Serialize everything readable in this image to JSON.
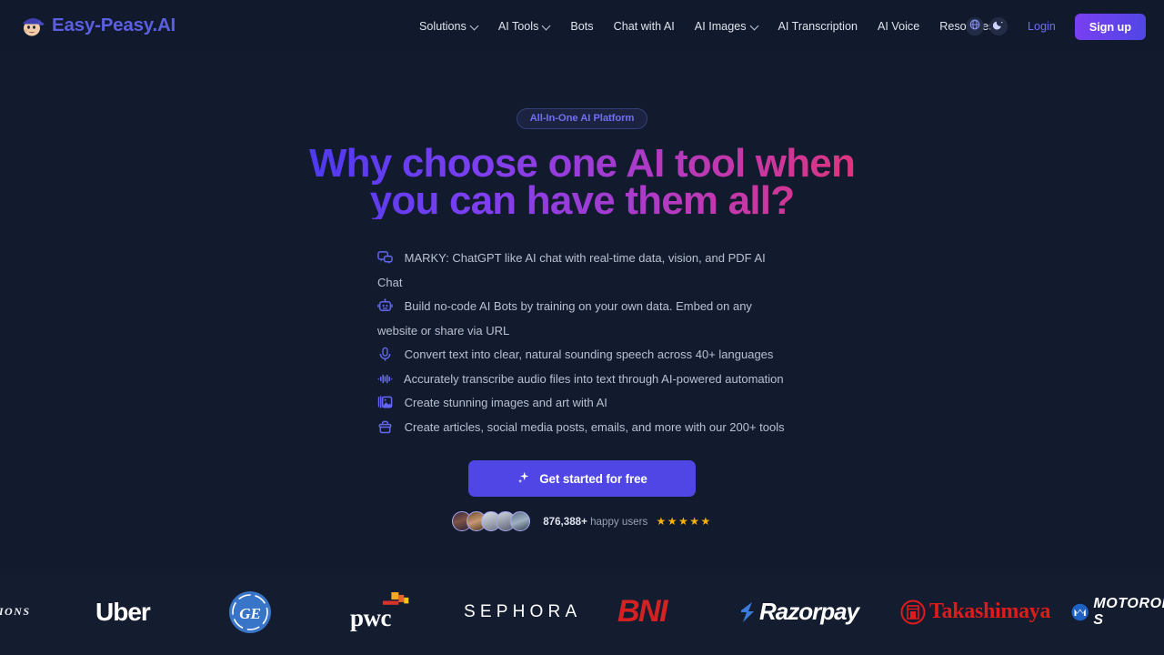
{
  "brand": {
    "name": "Easy-Peasy.AI",
    "logo_icon": "mascot-avatar-icon",
    "color": "#5b5fe0"
  },
  "nav": {
    "items": [
      {
        "label": "Solutions",
        "has_dropdown": true
      },
      {
        "label": "AI Tools",
        "has_dropdown": true
      },
      {
        "label": "Bots",
        "has_dropdown": false
      },
      {
        "label": "Chat with AI",
        "has_dropdown": false
      },
      {
        "label": "AI Images",
        "has_dropdown": true
      },
      {
        "label": "AI Transcription",
        "has_dropdown": false
      },
      {
        "label": "AI Voice",
        "has_dropdown": false
      },
      {
        "label": "Resources",
        "has_dropdown": true
      }
    ],
    "language_icon": "globe-icon",
    "theme_icon": "moon-icon",
    "login_label": "Login",
    "signup_label": "Sign up",
    "signup_color": "#5b46e8"
  },
  "hero": {
    "badge": "All-In-One AI Platform",
    "headline_line1": "Why choose one AI tool when",
    "headline_line2": "you can have them all?",
    "headline_gradient_from": "#4338f0",
    "headline_gradient_to": "#e8336f",
    "features": [
      {
        "icon": "chat-bubbles-icon",
        "text": "MARKY: ChatGPT like AI chat with real-time data, vision, and PDF AI Chat"
      },
      {
        "icon": "robot-icon",
        "text": "Build no-code AI Bots by training on your own data. Embed on any website or share via URL"
      },
      {
        "icon": "microphone-icon",
        "text": "Convert text into clear, natural sounding speech across 40+ languages"
      },
      {
        "icon": "audio-waveform-icon",
        "text": "Accurately transcribe audio files into text through AI-powered automation"
      },
      {
        "icon": "image-stack-icon",
        "text": "Create stunning images and art with AI"
      },
      {
        "icon": "toolbox-icon",
        "text": "Create articles, social media posts, emails, and more with our 200+ tools"
      }
    ],
    "cta_label": "Get started for free",
    "cta_icon": "sparkle-icon",
    "cta_color": "#4f46e5",
    "social_proof_count": "876,388+",
    "social_proof_text": "happy users",
    "stars": "★★★★★",
    "star_color": "#f5b106",
    "avatar_count": 5
  },
  "logos": {
    "items": [
      {
        "name": "emirates-partial",
        "text": "TIONS"
      },
      {
        "name": "uber",
        "text": "Uber"
      },
      {
        "name": "general-electric",
        "text": "GE"
      },
      {
        "name": "pwc",
        "text": "pwc"
      },
      {
        "name": "sephora",
        "text": "SEPHORA"
      },
      {
        "name": "bni",
        "text": "BNI"
      },
      {
        "name": "razorpay",
        "text": "Razorpay"
      },
      {
        "name": "takashimaya",
        "text": "Takashimaya"
      },
      {
        "name": "motorola",
        "text": "MOTOROLA S"
      }
    ]
  },
  "colors": {
    "page_background": "#121a2e",
    "header_background": "#111a2d",
    "logo_strip_background": "#141c30"
  }
}
